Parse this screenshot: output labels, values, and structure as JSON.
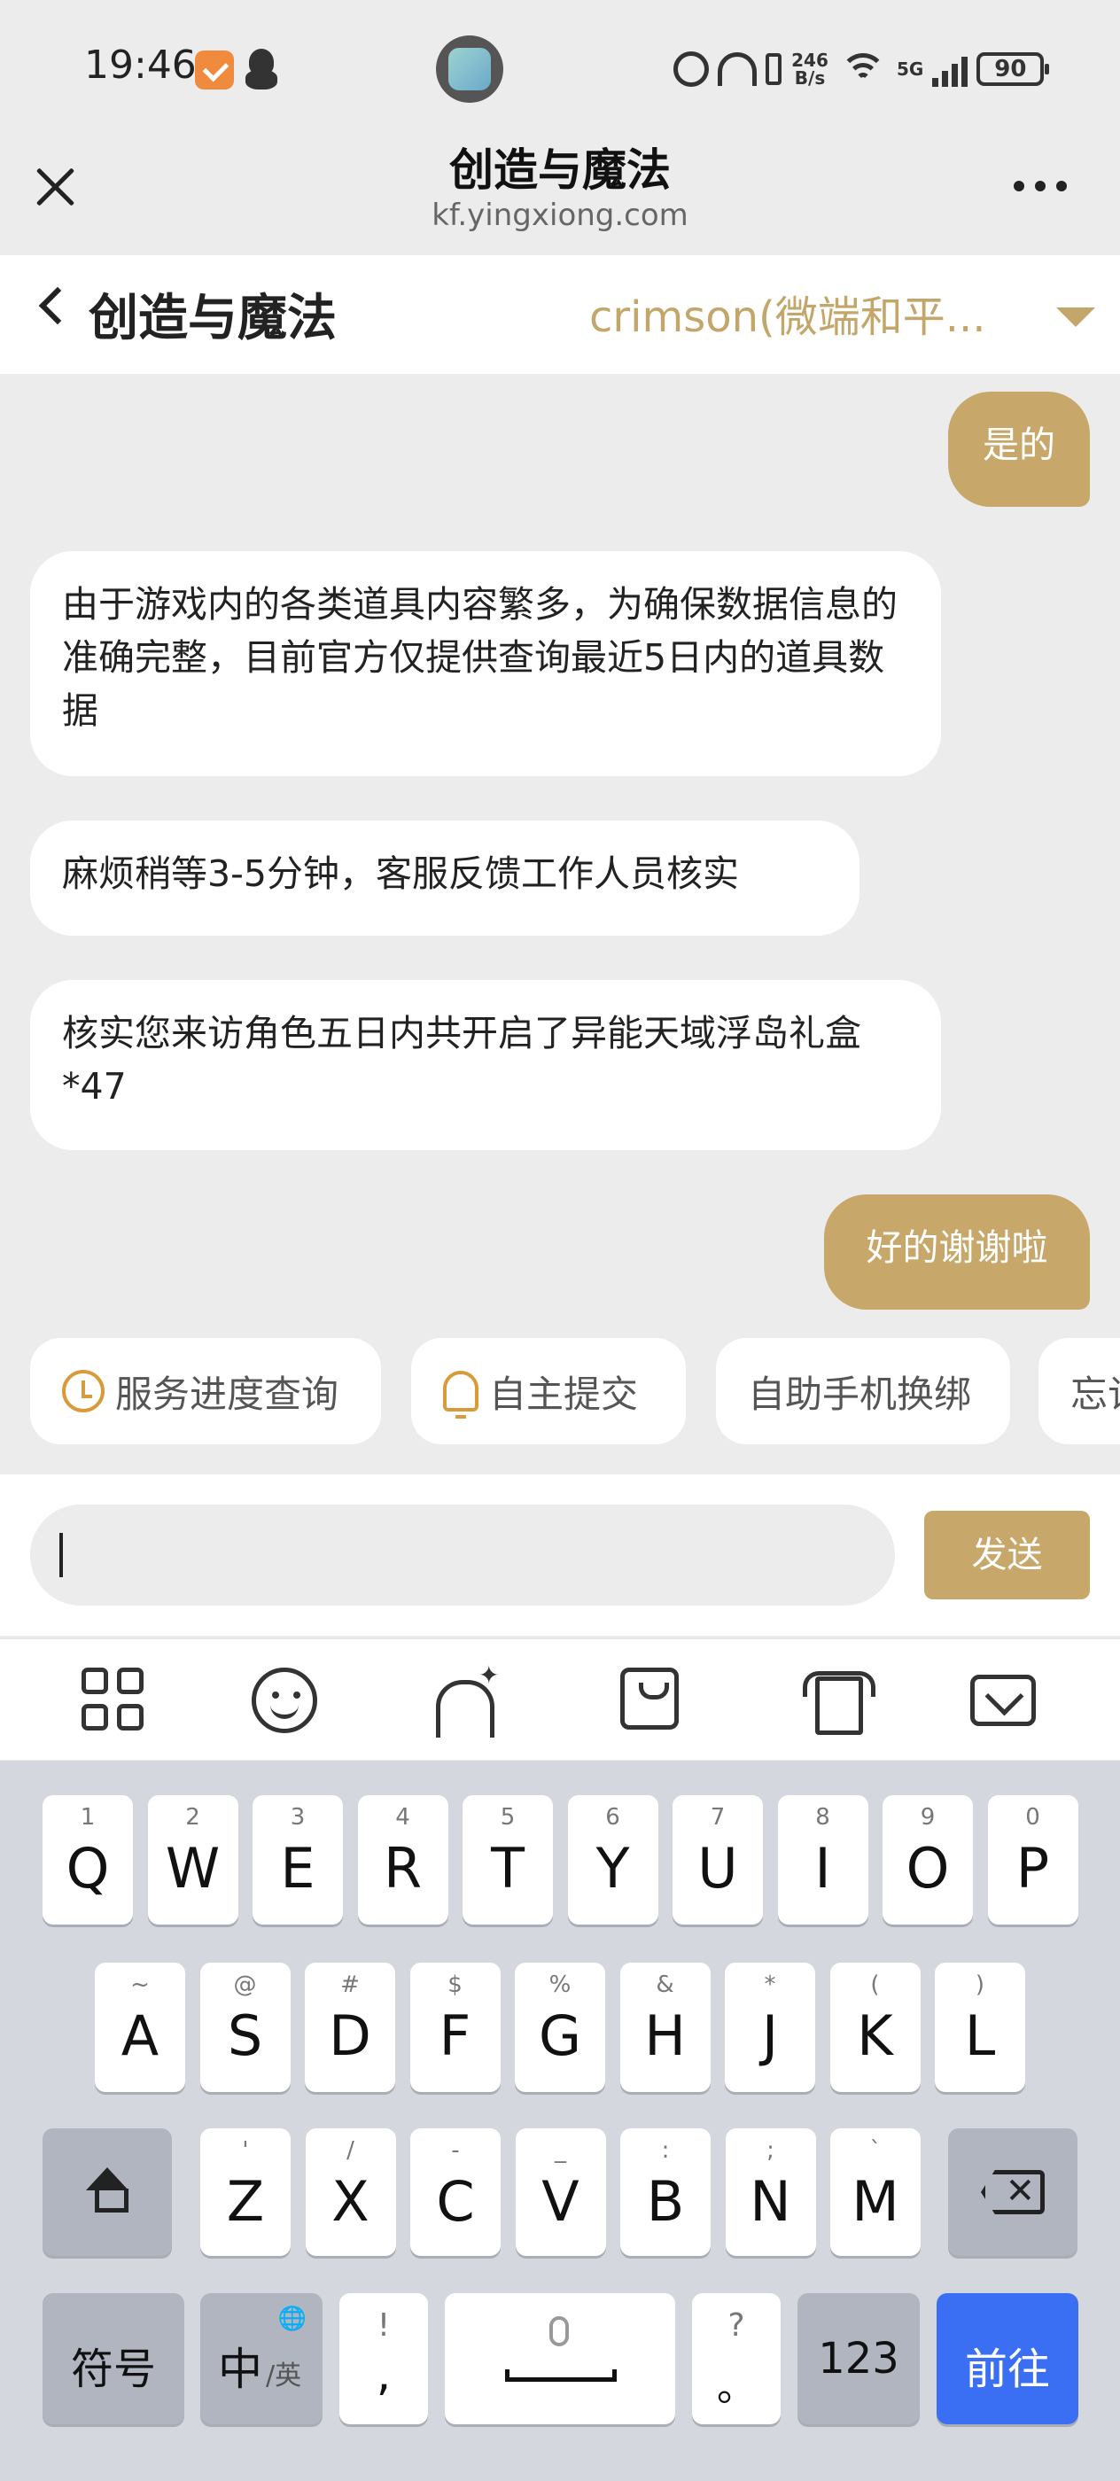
{
  "status_bar": {
    "time": "19:46",
    "net_speed_top": "246",
    "net_speed_unit": "B/s",
    "net_type": "5G",
    "battery": "90"
  },
  "web_bar": {
    "title": "创造与魔法",
    "url": "kf.yingxiong.com"
  },
  "page": {
    "title": "创造与魔法",
    "role_selector": "crimson(微端和平..."
  },
  "messages": [
    {
      "side": "out",
      "text": "是的"
    },
    {
      "side": "in",
      "text": "由于游戏内的各类道具内容繁多，为确保数据信息的准确完整，目前官方仅提供查询最近5日内的道具数据"
    },
    {
      "side": "in",
      "text": "麻烦稍等3-5分钟，客服反馈工作人员核实"
    },
    {
      "side": "in",
      "text": "核实您来访角色五日内共开启了异能天域浮岛礼盒*47"
    },
    {
      "side": "out",
      "text": "好的谢谢啦"
    }
  ],
  "quick_replies": [
    "服务进度查询",
    "自主提交",
    "自助手机换绑",
    "忘记"
  ],
  "input": {
    "value": "",
    "placeholder": ""
  },
  "send_label": "发送",
  "keyboard": {
    "row1": [
      {
        "k": "Q",
        "h": "1"
      },
      {
        "k": "W",
        "h": "2"
      },
      {
        "k": "E",
        "h": "3"
      },
      {
        "k": "R",
        "h": "4"
      },
      {
        "k": "T",
        "h": "5"
      },
      {
        "k": "Y",
        "h": "6"
      },
      {
        "k": "U",
        "h": "7"
      },
      {
        "k": "I",
        "h": "8"
      },
      {
        "k": "O",
        "h": "9"
      },
      {
        "k": "P",
        "h": "0"
      }
    ],
    "row2": [
      {
        "k": "A",
        "h": "~"
      },
      {
        "k": "S",
        "h": "@"
      },
      {
        "k": "D",
        "h": "#"
      },
      {
        "k": "F",
        "h": "$"
      },
      {
        "k": "G",
        "h": "%"
      },
      {
        "k": "H",
        "h": "&"
      },
      {
        "k": "J",
        "h": "*"
      },
      {
        "k": "K",
        "h": "("
      },
      {
        "k": "L",
        "h": ")"
      }
    ],
    "row3": [
      {
        "k": "Z",
        "h": "'"
      },
      {
        "k": "X",
        "h": "/"
      },
      {
        "k": "C",
        "h": "-"
      },
      {
        "k": "V",
        "h": "_"
      },
      {
        "k": "B",
        "h": ":"
      },
      {
        "k": "N",
        "h": ";"
      },
      {
        "k": "M",
        "h": "`"
      }
    ],
    "symbols": "符号",
    "lang_main": "中",
    "lang_alt": "/英",
    "comma_hint": "!",
    "comma": ",",
    "period_hint": "?",
    "period": "。",
    "numbers": "123",
    "go": "前往"
  }
}
